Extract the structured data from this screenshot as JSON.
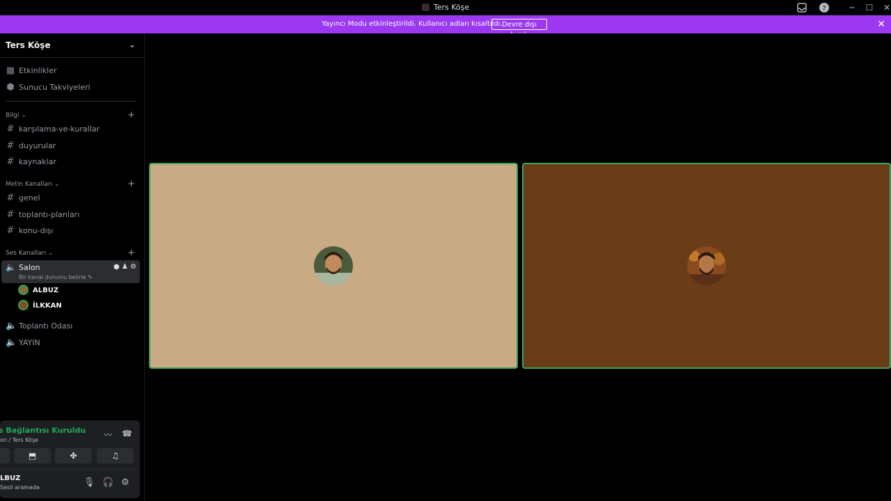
{
  "window": {
    "title": "Ters Köşe"
  },
  "banner": {
    "text": "Yayıncı Modu etkinleştirildi. Kullanıcı adları kısaltıldı.",
    "button": "Devre dışı bırak"
  },
  "server": {
    "name": "Ters Köşe",
    "top_items": [
      {
        "label": "Etkinlikler",
        "icon": "calendar-icon"
      },
      {
        "label": "Sunucu Takviyeleri",
        "icon": "boost-icon"
      }
    ],
    "categories": {
      "info": {
        "label": "Bilgi",
        "channels": [
          "karşılama-ve-kurallar",
          "duyurular",
          "kaynaklar"
        ]
      },
      "text": {
        "label": "Metin Kanalları",
        "channels": [
          "genel",
          "toplantı-planları",
          "konu-dışı"
        ]
      },
      "voice": {
        "label": "Ses Kanalları"
      }
    },
    "active_voice": {
      "name": "Salon",
      "status_placeholder": "Bir kanal durumu belirle",
      "members": [
        "ALBUZ",
        "İLKKAN"
      ]
    },
    "other_voice": [
      "Toplantı Odası",
      "YAYIN"
    ]
  },
  "voice_panel": {
    "status": "s Bağlantısı Kuruldu",
    "location": "on / Ters Köşe"
  },
  "user": {
    "name": "LBUZ",
    "status": "Sesli aramada"
  },
  "colors": {
    "banner": "#9b38f0",
    "connected": "#23a55a",
    "tile_left": "#c8aa84",
    "tile_right": "#6b3c18",
    "speaking_border": "#3ba55d"
  }
}
